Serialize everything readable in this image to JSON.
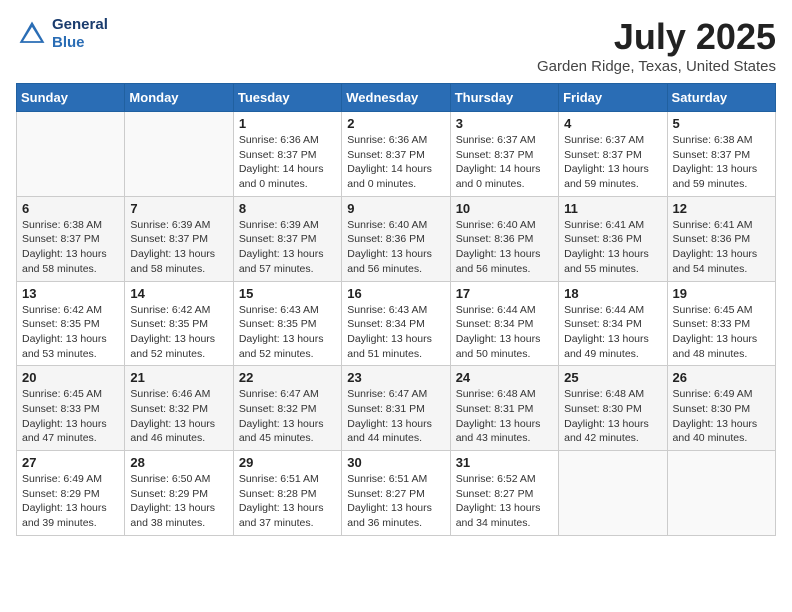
{
  "header": {
    "logo_line1": "General",
    "logo_line2": "Blue",
    "title": "July 2025",
    "subtitle": "Garden Ridge, Texas, United States"
  },
  "days_of_week": [
    "Sunday",
    "Monday",
    "Tuesday",
    "Wednesday",
    "Thursday",
    "Friday",
    "Saturday"
  ],
  "weeks": [
    [
      {
        "day": "",
        "content": ""
      },
      {
        "day": "",
        "content": ""
      },
      {
        "day": "1",
        "content": "Sunrise: 6:36 AM\nSunset: 8:37 PM\nDaylight: 14 hours and 0 minutes."
      },
      {
        "day": "2",
        "content": "Sunrise: 6:36 AM\nSunset: 8:37 PM\nDaylight: 14 hours and 0 minutes."
      },
      {
        "day": "3",
        "content": "Sunrise: 6:37 AM\nSunset: 8:37 PM\nDaylight: 14 hours and 0 minutes."
      },
      {
        "day": "4",
        "content": "Sunrise: 6:37 AM\nSunset: 8:37 PM\nDaylight: 13 hours and 59 minutes."
      },
      {
        "day": "5",
        "content": "Sunrise: 6:38 AM\nSunset: 8:37 PM\nDaylight: 13 hours and 59 minutes."
      }
    ],
    [
      {
        "day": "6",
        "content": "Sunrise: 6:38 AM\nSunset: 8:37 PM\nDaylight: 13 hours and 58 minutes."
      },
      {
        "day": "7",
        "content": "Sunrise: 6:39 AM\nSunset: 8:37 PM\nDaylight: 13 hours and 58 minutes."
      },
      {
        "day": "8",
        "content": "Sunrise: 6:39 AM\nSunset: 8:37 PM\nDaylight: 13 hours and 57 minutes."
      },
      {
        "day": "9",
        "content": "Sunrise: 6:40 AM\nSunset: 8:36 PM\nDaylight: 13 hours and 56 minutes."
      },
      {
        "day": "10",
        "content": "Sunrise: 6:40 AM\nSunset: 8:36 PM\nDaylight: 13 hours and 56 minutes."
      },
      {
        "day": "11",
        "content": "Sunrise: 6:41 AM\nSunset: 8:36 PM\nDaylight: 13 hours and 55 minutes."
      },
      {
        "day": "12",
        "content": "Sunrise: 6:41 AM\nSunset: 8:36 PM\nDaylight: 13 hours and 54 minutes."
      }
    ],
    [
      {
        "day": "13",
        "content": "Sunrise: 6:42 AM\nSunset: 8:35 PM\nDaylight: 13 hours and 53 minutes."
      },
      {
        "day": "14",
        "content": "Sunrise: 6:42 AM\nSunset: 8:35 PM\nDaylight: 13 hours and 52 minutes."
      },
      {
        "day": "15",
        "content": "Sunrise: 6:43 AM\nSunset: 8:35 PM\nDaylight: 13 hours and 52 minutes."
      },
      {
        "day": "16",
        "content": "Sunrise: 6:43 AM\nSunset: 8:34 PM\nDaylight: 13 hours and 51 minutes."
      },
      {
        "day": "17",
        "content": "Sunrise: 6:44 AM\nSunset: 8:34 PM\nDaylight: 13 hours and 50 minutes."
      },
      {
        "day": "18",
        "content": "Sunrise: 6:44 AM\nSunset: 8:34 PM\nDaylight: 13 hours and 49 minutes."
      },
      {
        "day": "19",
        "content": "Sunrise: 6:45 AM\nSunset: 8:33 PM\nDaylight: 13 hours and 48 minutes."
      }
    ],
    [
      {
        "day": "20",
        "content": "Sunrise: 6:45 AM\nSunset: 8:33 PM\nDaylight: 13 hours and 47 minutes."
      },
      {
        "day": "21",
        "content": "Sunrise: 6:46 AM\nSunset: 8:32 PM\nDaylight: 13 hours and 46 minutes."
      },
      {
        "day": "22",
        "content": "Sunrise: 6:47 AM\nSunset: 8:32 PM\nDaylight: 13 hours and 45 minutes."
      },
      {
        "day": "23",
        "content": "Sunrise: 6:47 AM\nSunset: 8:31 PM\nDaylight: 13 hours and 44 minutes."
      },
      {
        "day": "24",
        "content": "Sunrise: 6:48 AM\nSunset: 8:31 PM\nDaylight: 13 hours and 43 minutes."
      },
      {
        "day": "25",
        "content": "Sunrise: 6:48 AM\nSunset: 8:30 PM\nDaylight: 13 hours and 42 minutes."
      },
      {
        "day": "26",
        "content": "Sunrise: 6:49 AM\nSunset: 8:30 PM\nDaylight: 13 hours and 40 minutes."
      }
    ],
    [
      {
        "day": "27",
        "content": "Sunrise: 6:49 AM\nSunset: 8:29 PM\nDaylight: 13 hours and 39 minutes."
      },
      {
        "day": "28",
        "content": "Sunrise: 6:50 AM\nSunset: 8:29 PM\nDaylight: 13 hours and 38 minutes."
      },
      {
        "day": "29",
        "content": "Sunrise: 6:51 AM\nSunset: 8:28 PM\nDaylight: 13 hours and 37 minutes."
      },
      {
        "day": "30",
        "content": "Sunrise: 6:51 AM\nSunset: 8:27 PM\nDaylight: 13 hours and 36 minutes."
      },
      {
        "day": "31",
        "content": "Sunrise: 6:52 AM\nSunset: 8:27 PM\nDaylight: 13 hours and 34 minutes."
      },
      {
        "day": "",
        "content": ""
      },
      {
        "day": "",
        "content": ""
      }
    ]
  ]
}
